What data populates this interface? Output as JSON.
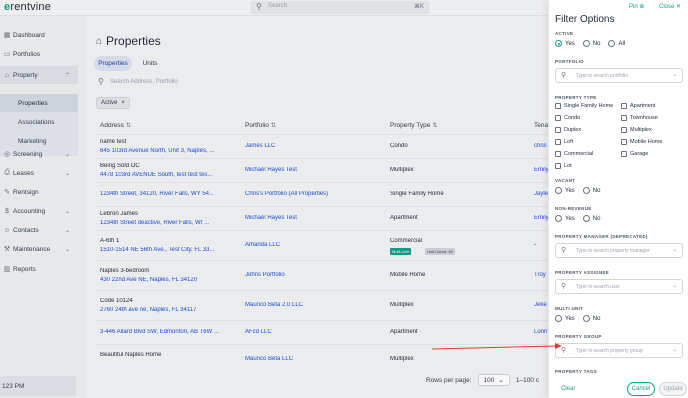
{
  "app": {
    "logo": "rentvine",
    "logo_mark": "e"
  },
  "top_search": {
    "placeholder": "Search",
    "shortcut": "⌘K"
  },
  "sidebar": {
    "items": [
      {
        "label": "Dashboard",
        "icon": "grid-icon"
      },
      {
        "label": "Portfolios",
        "icon": "folder-icon"
      },
      {
        "label": "Property",
        "icon": "home-icon",
        "chevron": "⌃"
      },
      {
        "label": "Screening",
        "icon": "screening-icon",
        "chevron": "⌄"
      },
      {
        "label": "Leases",
        "icon": "lease-icon",
        "chevron": "⌄"
      },
      {
        "label": "Rentsign",
        "icon": "sign-icon"
      },
      {
        "label": "Accounting",
        "icon": "dollar-icon",
        "chevron": "⌄"
      },
      {
        "label": "Contacts",
        "icon": "contacts-icon",
        "chevron": "⌄"
      },
      {
        "label": "Maintenance",
        "icon": "wrench-icon",
        "chevron": "⌄"
      },
      {
        "label": "Reports",
        "icon": "reports-icon"
      }
    ],
    "sub_items": [
      "Properties",
      "Associations",
      "Marketing"
    ],
    "time": "123 PM"
  },
  "main": {
    "title": "Properties",
    "tabs": [
      "Properties",
      "Units"
    ],
    "search_placeholder": "Search Address, Portfolio",
    "filter_chip": "Active",
    "columns": [
      "Address",
      "Portfolio",
      "Property Type",
      "Tena"
    ],
    "rows": [
      {
        "name": "name test",
        "address": "645 103rd Avenue North, Unit 3, Naples, ...",
        "portfolio": "James LLC",
        "type": "Condo",
        "tenant": "chris"
      },
      {
        "name": "Being Sold OC",
        "address": "4478 103rd AVENUE South, test test tes...",
        "portfolio": "Michael Hayes Test",
        "type": "Multiplex",
        "tenant": "Emily"
      },
      {
        "name": "",
        "address": "1234th Street, 34120, River Falls, WY 54...",
        "portfolio": "Chris's Portfolio (All Properties)",
        "type": "Single Family Home",
        "tenant": "Jayle"
      },
      {
        "name": "Lebron James",
        "address": "1234th Street deactive, River Falls, WI ...",
        "portfolio": "Michael Hayes Test",
        "type": "Apartment",
        "tenant": "Emily"
      },
      {
        "name": "A-6th 1",
        "address": "1510-1514 NE 56th Ave., Test City, FL 33...",
        "portfolio": "Amanda LLC",
        "type": "Commercial",
        "tenant": "-",
        "badges": [
          "Multi-Unit",
          "Unit Count: 16"
        ]
      },
      {
        "name": "Naples 3-bedroom",
        "address": "430 22nd Ave NE, Naples, FL 34120",
        "portfolio": "Johns Portfolio",
        "type": "Mobile Home",
        "tenant": "Troy"
      },
      {
        "name": "Code 10124",
        "address": "2760 24th ave ne, Naples, FL 34117",
        "portfolio": "Maurico Beta 2.0 LLC",
        "type": "Multiplex",
        "tenant": "Jeke"
      },
      {
        "name": "",
        "address": "3-446 Allard Blvd SW, Edmonton, AB T6W ...",
        "portfolio": "AFcd LLC",
        "type": "Apartment",
        "tenant": "Lonn"
      },
      {
        "name": "Beautiful Naples Home",
        "address": "",
        "portfolio": "Maurico Beta LLC",
        "type": "Multiplex",
        "tenant": ""
      }
    ],
    "pager": {
      "label": "Rows per page:",
      "value": "100",
      "range": "1–100 c"
    }
  },
  "filter_panel": {
    "title": "Filter Options",
    "pin": "Pin",
    "close": "Close",
    "active_label": "ACTIVE",
    "active_options": [
      "Yes",
      "No",
      "All"
    ],
    "portfolio_label": "PORTFOLIO",
    "portfolio_placeholder": "Type to search portfolio",
    "property_type_label": "PROPERTY TYPE",
    "property_types_left": [
      "Single Family Home",
      "Condo",
      "Duplex",
      "Loft",
      "Commercial",
      "Lot"
    ],
    "property_types_right": [
      "Apartment",
      "Townhouse",
      "Multiplex",
      "Mobile Home",
      "Garage"
    ],
    "vacant_label": "VACANT",
    "vacant_options": [
      "Yes",
      "No"
    ],
    "nonrev_label": "NON-REVENUE",
    "nonrev_options": [
      "Yes",
      "No"
    ],
    "pm_label": "PROPERTY MANAGER (DEPRECATED)",
    "pm_placeholder": "Type to search property manager",
    "assignee_label": "PROPERTY ASSIGNEE",
    "assignee_placeholder": "Type to search user",
    "multiunit_label": "MULTI UNIT",
    "multiunit_options": [
      "Yes",
      "No"
    ],
    "group_label": "PROPERTY GROUP",
    "group_placeholder": "Type to search property group",
    "tags_label": "PROPERTY TAGS",
    "clear": "Clear",
    "cancel": "Cancel",
    "update": "Update"
  },
  "colors": {
    "accent": "#1a9b8a",
    "link": "#1d4ed8",
    "annotation_arrow": "#e53935"
  }
}
